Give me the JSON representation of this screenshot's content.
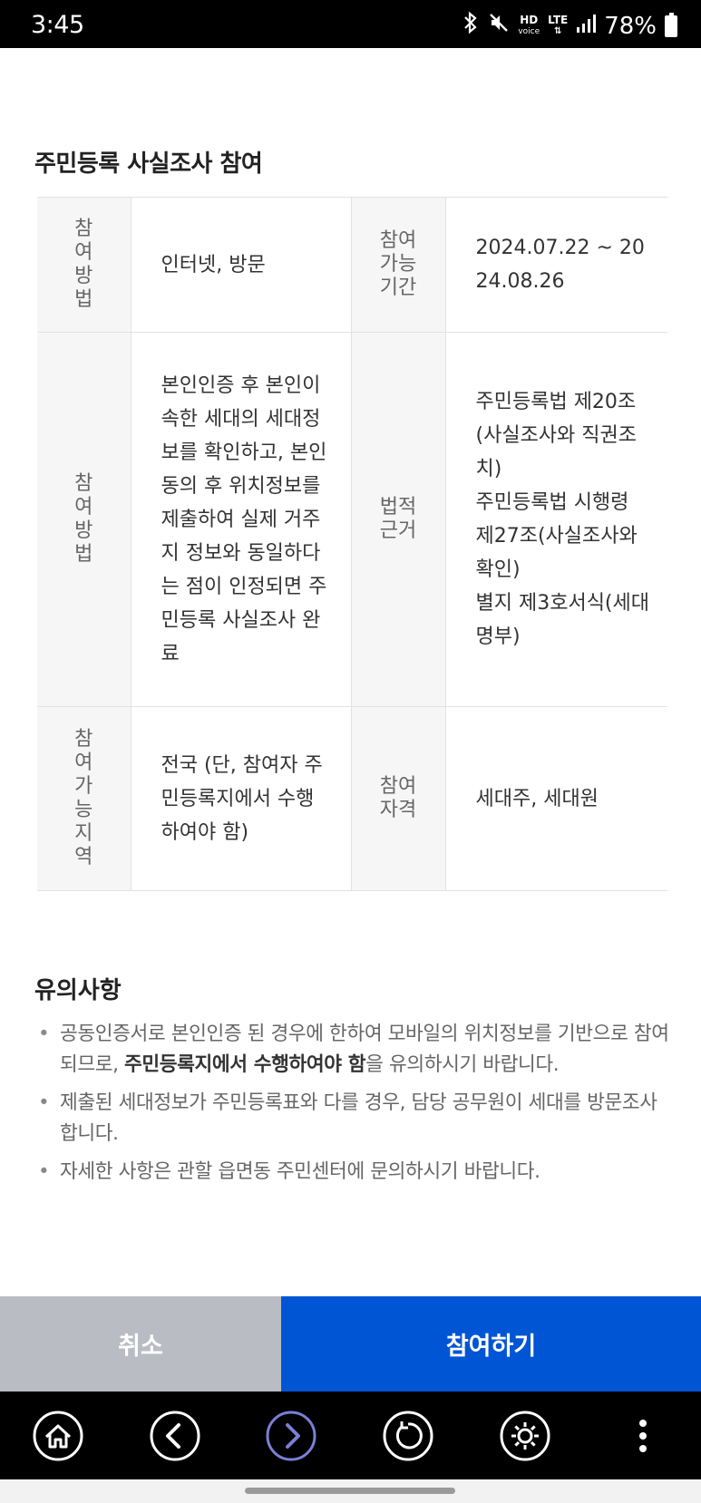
{
  "status_bar": {
    "time": "3:45",
    "hd_line1": "HD",
    "hd_line2": "voice",
    "lte": "LTE",
    "battery": "78%"
  },
  "section": {
    "title": "주민등록 사실조사 참여",
    "rows": [
      {
        "h1": "참여방법",
        "v1": "인터넷, 방문",
        "h2": "참여가능기간",
        "v2": "2024.07.22 ~ 2024.08.26"
      },
      {
        "h1": "참여방법",
        "v1": "본인인증 후 본인이 속한 세대의 세대정보를 확인하고, 본인 동의 후 위치정보를 제출하여 실제 거주지 정보와 동일하다는 점이 인정되면 주민등록 사실조사 완료",
        "h2": "법적근거",
        "v2_lines": [
          "주민등록법 제20조(사실조사와 직권조치)",
          "주민등록법 시행령 제27조(사실조사와 확인)",
          "별지 제3호서식(세대명부)"
        ]
      },
      {
        "h1": "참여가능지역",
        "v1": "전국 (단, 참여자 주민등록지에서 수행하여야 함)",
        "h2": "참여자격",
        "v2": "세대주, 세대원"
      }
    ]
  },
  "notice": {
    "title": "유의사항",
    "item1_pre": "공동인증서로 본인인증 된 경우에 한하여 모바일의 위치정보를 기반으로 참여되므로, ",
    "item1_bold": "주민등록지에서 수행하여야 함",
    "item1_post": "을 유의하시기 바랍니다.",
    "item2": "제출된 세대정보가 주민등록표와 다를 경우, 담당 공무원이 세대를 방문조사합니다.",
    "item3": "자세한 사항은 관할 읍면동 주민센터에 문의하시기 바랍니다."
  },
  "actions": {
    "cancel": "취소",
    "join": "참여하기"
  },
  "browser_nav": {
    "icons": [
      "home-icon",
      "back-icon",
      "forward-icon",
      "refresh-icon",
      "settings-icon",
      "more-icon"
    ],
    "forward_color": "#7b7fd4"
  }
}
